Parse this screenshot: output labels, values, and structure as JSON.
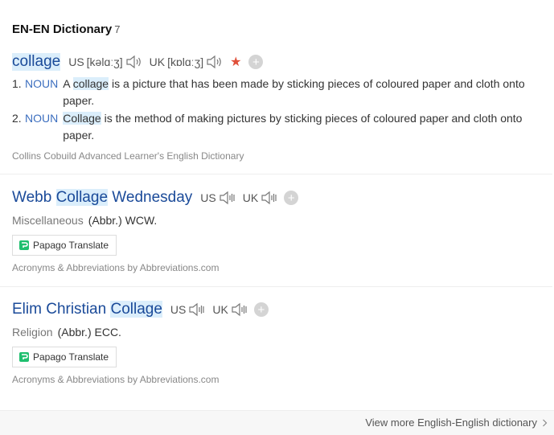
{
  "section": {
    "title": "EN-EN Dictionary",
    "count": "7"
  },
  "entry1": {
    "headword": "collage",
    "us_label": "US",
    "us_phonetic": "[kəlɑːʒ]",
    "uk_label": "UK",
    "uk_phonetic": "[kɒlɑːʒ]",
    "defs": [
      {
        "num": "1.",
        "pos": "NOUN",
        "pre": "A ",
        "hl": "collage",
        "post": " is a picture that has been made by sticking pieces of coloured paper and cloth onto paper."
      },
      {
        "num": "2.",
        "pos": "NOUN",
        "pre": "",
        "hl": "Collage",
        "post": " is the method of making pictures by sticking pieces of coloured paper and cloth onto paper."
      }
    ],
    "source": "Collins Cobuild Advanced Learner's English Dictionary"
  },
  "entry2": {
    "pre": "Webb ",
    "hl": "Collage",
    "post": " Wednesday",
    "us_label": "US",
    "uk_label": "UK",
    "tag": "Miscellaneous",
    "meaning": "(Abbr.) WCW.",
    "papago": "Papago Translate",
    "source": "Acronyms & Abbreviations by Abbreviations.com"
  },
  "entry3": {
    "pre": "Elim Christian ",
    "hl": "Collage",
    "post": "",
    "us_label": "US",
    "uk_label": "UK",
    "tag": "Religion",
    "meaning": "(Abbr.) ECC.",
    "papago": "Papago Translate",
    "source": "Acronyms & Abbreviations by Abbreviations.com"
  },
  "footer": {
    "more": "View more English-English dictionary"
  },
  "icons": {
    "speaker": "speaker-icon",
    "star": "star-icon",
    "plus": "plus-icon",
    "chevron": "chevron-right-icon",
    "papago": "papago-logo-icon"
  },
  "colors": {
    "link": "#1a4a99",
    "highlight": "#dbeefb",
    "star": "#e0503a",
    "pos": "#3d6fbf"
  }
}
